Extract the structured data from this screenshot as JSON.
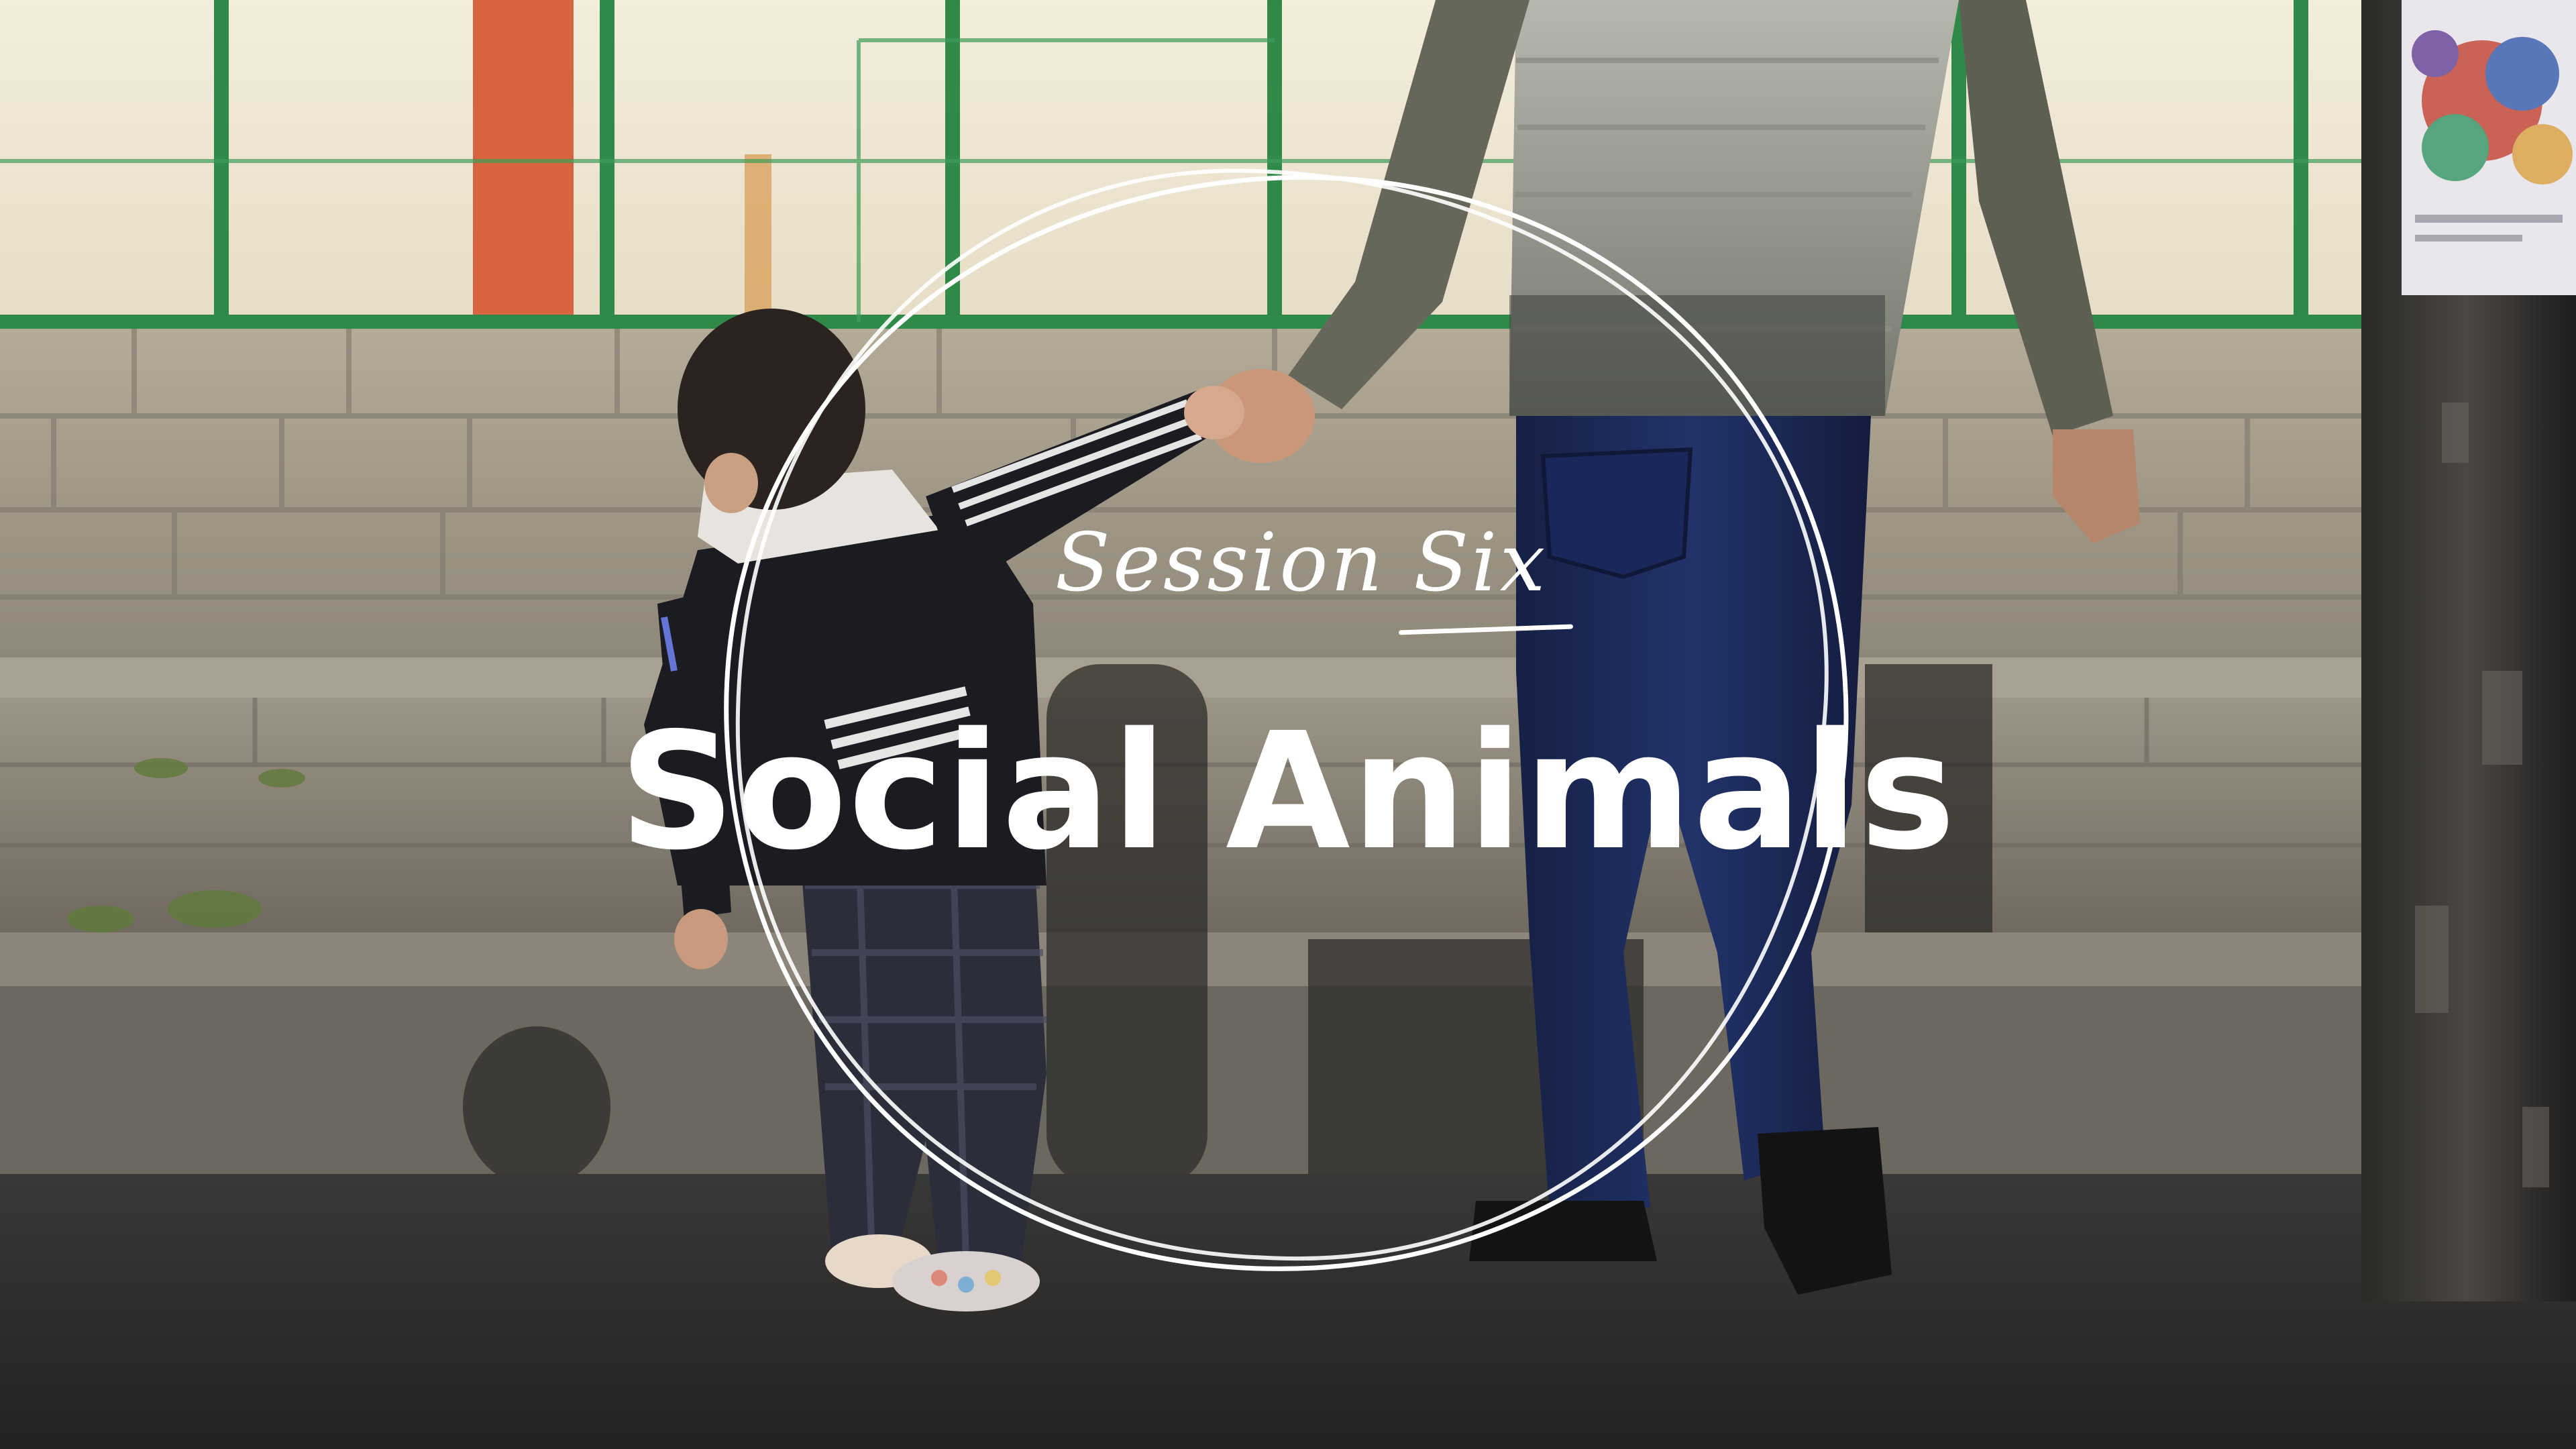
{
  "title": {
    "session_label": "Session Six",
    "main_title": "Social Animals"
  },
  "colors": {
    "text": "#ffffff",
    "fence_green": "#2f8a4a",
    "wall_stone": "#a09686",
    "pavement": "#2c2c2c",
    "jacket": "#1b1b22",
    "jeans": "#1d2a55",
    "vest": "#9c9e94"
  },
  "ring": {
    "style": "double hand-drawn circle outline"
  },
  "scene": {
    "description_icons": [
      "photo-background",
      "circle-frame-icon"
    ]
  }
}
